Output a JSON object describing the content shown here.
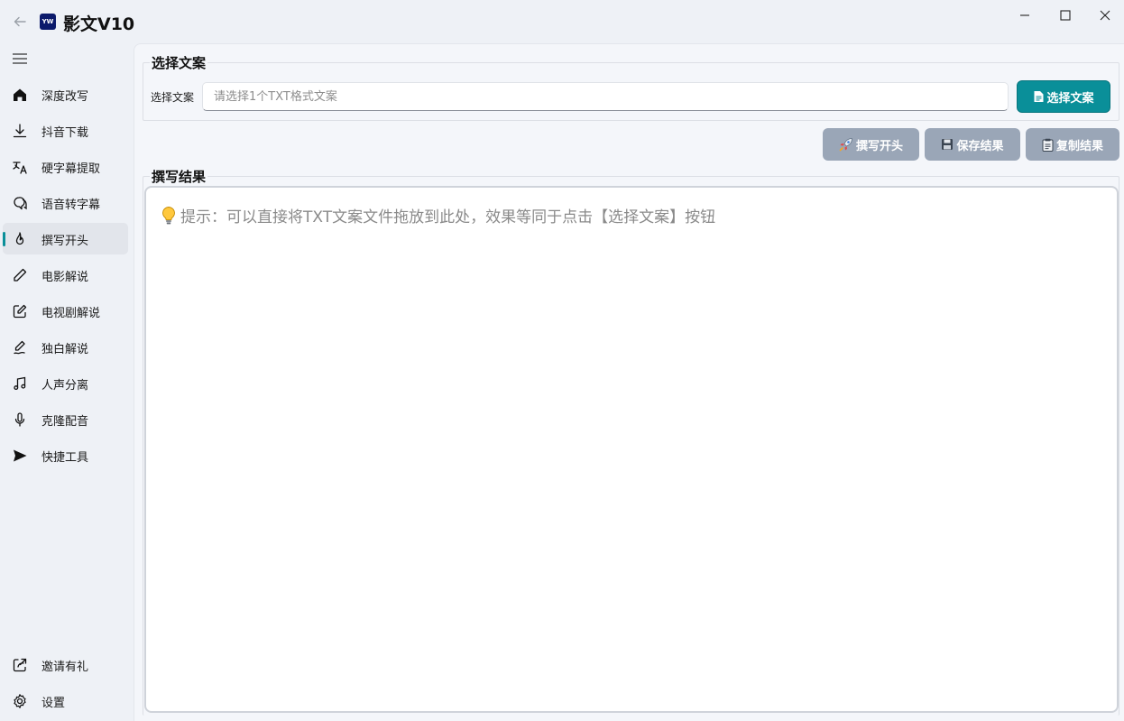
{
  "app": {
    "title": "影文V10",
    "logo_text": "YW"
  },
  "sidebar": {
    "items": [
      {
        "label": "深度改写",
        "icon": "home-icon"
      },
      {
        "label": "抖音下载",
        "icon": "download-icon"
      },
      {
        "label": "硬字幕提取",
        "icon": "subtitle-extract-icon"
      },
      {
        "label": "语音转字幕",
        "icon": "speech-bubble-icon"
      },
      {
        "label": "撰写开头",
        "icon": "flame-icon",
        "active": true
      },
      {
        "label": "电影解说",
        "icon": "pencil-icon"
      },
      {
        "label": "电视剧解说",
        "icon": "edit-square-icon"
      },
      {
        "label": "独白解说",
        "icon": "pen-signature-icon"
      },
      {
        "label": "人声分离",
        "icon": "music-note-icon"
      },
      {
        "label": "克隆配音",
        "icon": "microphone-icon"
      },
      {
        "label": "快捷工具",
        "icon": "send-icon"
      }
    ],
    "bottom_items": [
      {
        "label": "邀请有礼",
        "icon": "share-icon"
      },
      {
        "label": "设置",
        "icon": "gear-icon"
      }
    ]
  },
  "select_section": {
    "title": "选择文案",
    "field_label": "选择文案",
    "placeholder": "请选择1个TXT格式文案",
    "button_label": "选择文案"
  },
  "actions": {
    "write_opening": "撰写开头",
    "save_result": "保存结果",
    "copy_result": "复制结果"
  },
  "result_section": {
    "title": "撰写结果",
    "hint": "提示：可以直接将TXT文案文件拖放到此处，效果等同于点击【选择文案】按钮"
  },
  "colors": {
    "accent": "#0a8f99",
    "button_gray": "#9aa6b7",
    "logo": "#0b1a6b"
  }
}
